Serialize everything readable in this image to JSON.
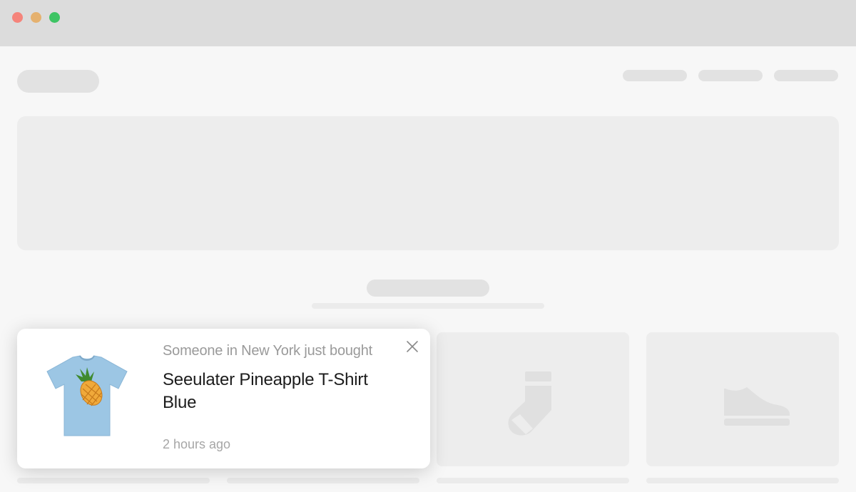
{
  "window": {
    "controls": [
      "close",
      "minimize",
      "maximize"
    ],
    "colors": {
      "close": "#f5847b",
      "minimize": "#e5b16f",
      "maximize": "#3ec464"
    }
  },
  "product_cards": [
    {
      "icon": "tshirt-icon"
    },
    {
      "icon": "blank"
    },
    {
      "icon": "sock-icon"
    },
    {
      "icon": "shoe-icon"
    }
  ],
  "notification": {
    "subtitle": "Someone in New York just bought",
    "product_name": "Seeulater Pineapple T-Shirt Blue",
    "time_ago": "2 hours ago",
    "product_image": "blue-pineapple-tshirt",
    "close_icon": "close-icon"
  }
}
